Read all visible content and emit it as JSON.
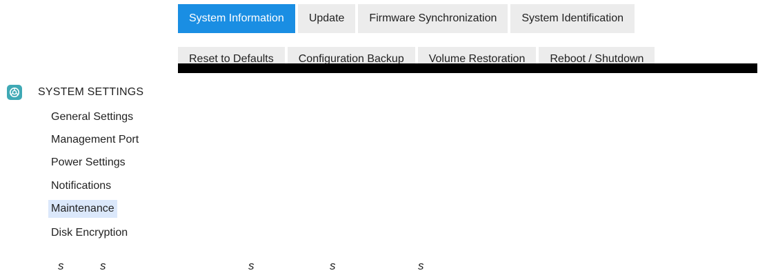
{
  "tabs_primary": [
    {
      "label": "System Information",
      "active": true
    },
    {
      "label": "Update",
      "active": false
    },
    {
      "label": "Firmware Synchronization",
      "active": false
    },
    {
      "label": "System Identification",
      "active": false
    }
  ],
  "tabs_secondary": [
    {
      "label": "Reset to Defaults"
    },
    {
      "label": "Configuration Backup"
    },
    {
      "label": "Volume Restoration"
    },
    {
      "label": "Reboot / Shutdown"
    }
  ],
  "sidebar": {
    "section_icon": "system-settings-icon",
    "section_title": "SYSTEM SETTINGS",
    "items": [
      {
        "label": "General Settings",
        "selected": false
      },
      {
        "label": "Management Port",
        "selected": false
      },
      {
        "label": "Power Settings",
        "selected": false
      },
      {
        "label": "Notifications",
        "selected": false
      },
      {
        "label": "Maintenance",
        "selected": true
      },
      {
        "label": "Disk Encryption",
        "selected": false
      }
    ]
  },
  "bottom_glyphs": [
    "s",
    "s",
    "s",
    "s",
    "s"
  ],
  "colors": {
    "active_tab": "#1a8ee3",
    "tab_background": "#ececec",
    "selected_item": "#dbe8fb",
    "icon_background": "#3fa9b5"
  }
}
